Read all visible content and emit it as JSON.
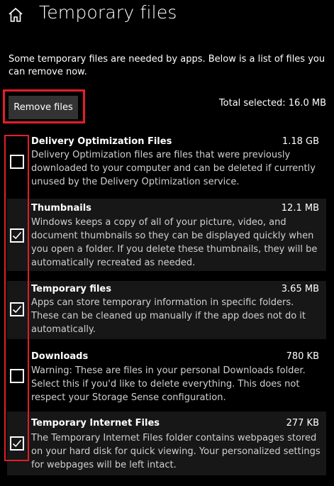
{
  "header": {
    "title": "Temporary files"
  },
  "description": "Some temporary files are needed by apps. Below is a list of files you can remove now.",
  "toolbar": {
    "remove_label": "Remove files",
    "total_selected": "Total selected: 16.0 MB"
  },
  "items": [
    {
      "name": "Delivery Optimization Files",
      "size": "1.18 GB",
      "checked": false,
      "description": "Delivery Optimization files are files that were previously downloaded to your computer and can be deleted if currently unused by the Delivery Optimization service."
    },
    {
      "name": "Thumbnails",
      "size": "12.1 MB",
      "checked": true,
      "description": "Windows keeps a copy of all of your picture, video, and document thumbnails so they can be displayed quickly when you open a folder. If you delete these thumbnails, they will be automatically recreated as needed."
    },
    {
      "name": "Temporary files",
      "size": "3.65 MB",
      "checked": true,
      "description": "Apps can store temporary information in specific folders. These can be cleaned up manually if the app does not do it automatically."
    },
    {
      "name": "Downloads",
      "size": "780 KB",
      "checked": false,
      "description": "Warning: These are files in your personal Downloads folder. Select this if you'd like to delete everything. This does not respect your Storage Sense configuration."
    },
    {
      "name": "Temporary Internet Files",
      "size": "277 KB",
      "checked": true,
      "description": "The Temporary Internet Files folder contains webpages stored on your hard disk for quick viewing. Your personalized settings for webpages will be left intact."
    }
  ],
  "colors": {
    "background": "#000000",
    "alt_row": "#171717",
    "button": "#333333",
    "highlight": "#e21f29"
  }
}
